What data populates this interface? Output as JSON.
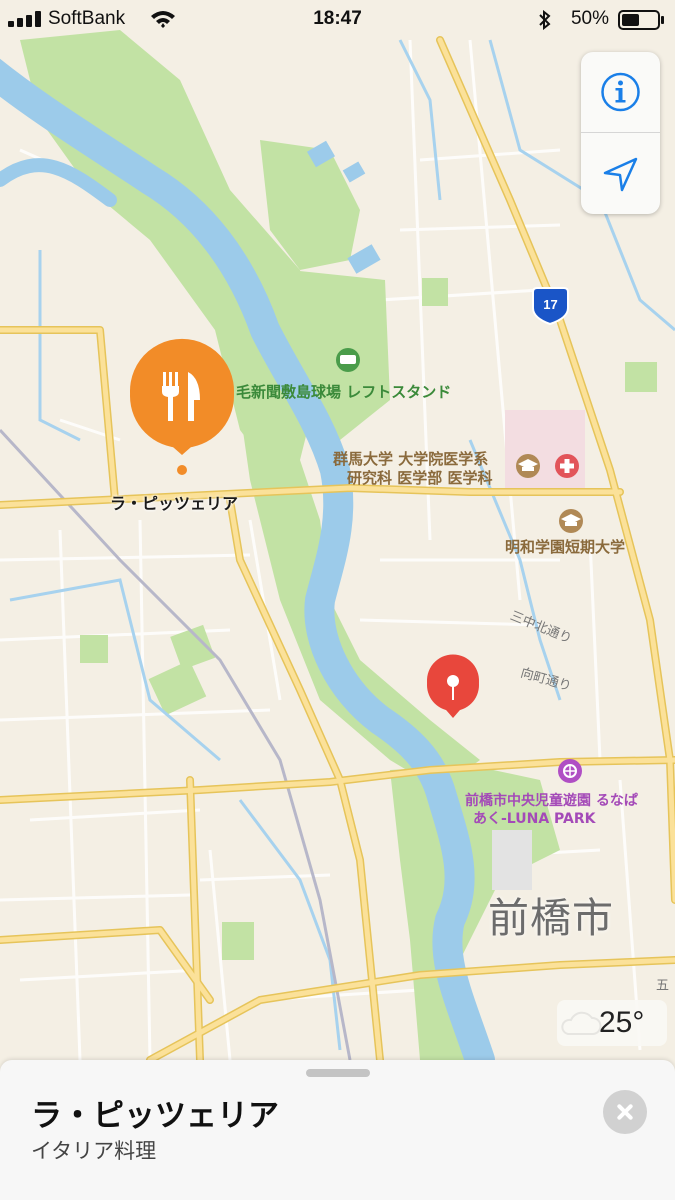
{
  "status_bar": {
    "carrier": "SoftBank",
    "time": "18:47",
    "battery_percent": "50%",
    "battery_level": 0.5
  },
  "map_controls": {
    "info_icon": "info-icon",
    "location_icon": "location-arrow-icon"
  },
  "map": {
    "highway_number": "17",
    "poi_stadium": "毛新聞敷島球場 レフトスタンド",
    "poi_university": [
      "群馬大学 大学院医学系",
      "研究科 医学部 医学科"
    ],
    "poi_college": "明和学園短期大学",
    "road_sannaka": "三中北通り",
    "road_mukaimachi": "向町通り",
    "poi_park": [
      "前橋市中央児童遊園 るなぱ",
      "あく-LUNA PARK"
    ],
    "city_name": "前橋市",
    "selected_place_label": "ラ・ピッツェリア",
    "edge_label": "五"
  },
  "weather": {
    "icon": "cloud-icon",
    "temperature": "25°"
  },
  "place_card": {
    "title": "ラ・ピッツェリア",
    "category": "イタリア料理"
  },
  "colors": {
    "land": "#f4efe4",
    "water": "#9ccbea",
    "park": "#c2e2a4",
    "major_road": "#f7d56e",
    "accent_blue": "#1a7fe8",
    "restaurant_orange": "#f28c28",
    "pin_red": "#e8473c"
  }
}
